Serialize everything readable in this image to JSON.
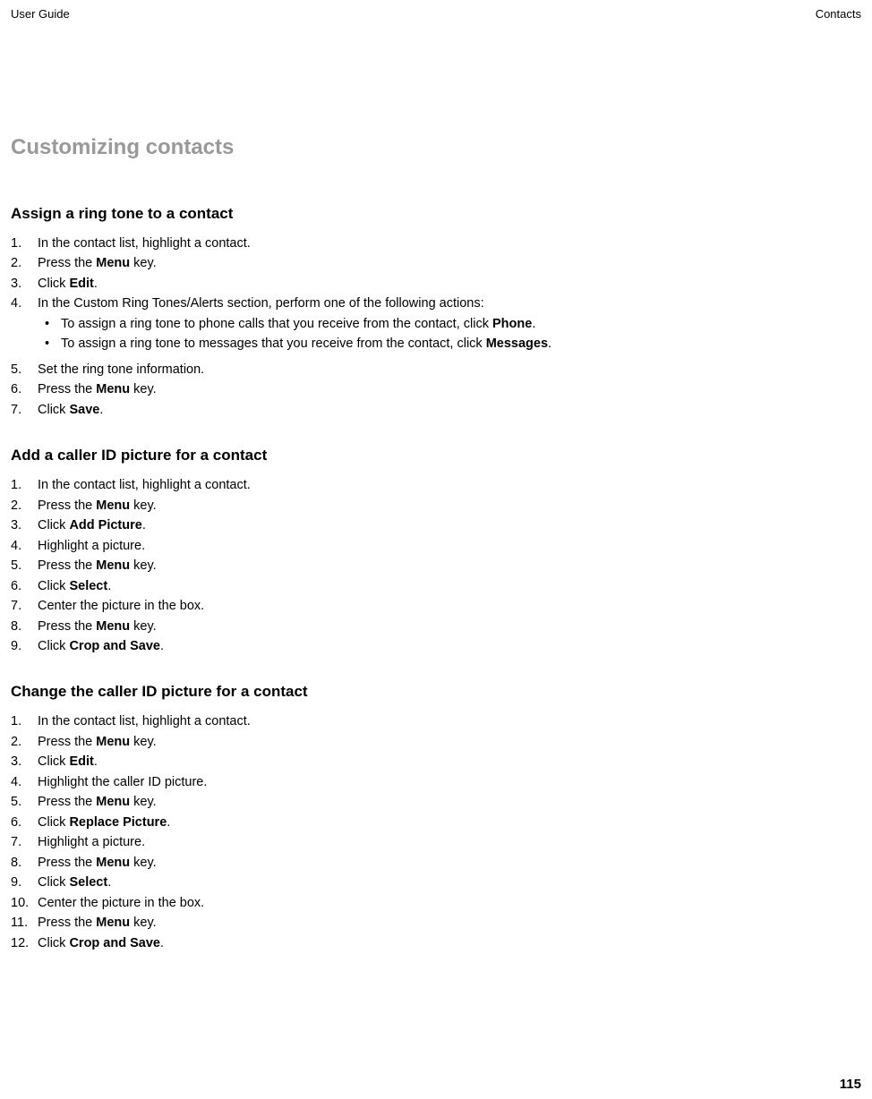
{
  "header": {
    "left": "User Guide",
    "right": "Contacts"
  },
  "main_heading": "Customizing contacts",
  "sections": [
    {
      "heading": "Assign a ring tone to a contact",
      "steps": [
        [
          {
            "t": "In the contact list, highlight a contact."
          }
        ],
        [
          {
            "t": "Press the "
          },
          {
            "t": "Menu",
            "b": true
          },
          {
            "t": " key."
          }
        ],
        [
          {
            "t": "Click "
          },
          {
            "t": "Edit",
            "b": true
          },
          {
            "t": "."
          }
        ],
        [
          {
            "t": "In the Custom Ring Tones/Alerts section, perform one of the following actions:"
          }
        ],
        [
          {
            "t": "Set the ring tone information."
          }
        ],
        [
          {
            "t": "Press the "
          },
          {
            "t": "Menu",
            "b": true
          },
          {
            "t": " key."
          }
        ],
        [
          {
            "t": "Click "
          },
          {
            "t": "Save",
            "b": true
          },
          {
            "t": "."
          }
        ]
      ],
      "sub_after_step": 4,
      "subs": [
        [
          {
            "t": "To assign a ring tone to phone calls that you receive from the contact, click "
          },
          {
            "t": "Phone",
            "b": true
          },
          {
            "t": "."
          }
        ],
        [
          {
            "t": "To assign a ring tone to messages that you receive from the contact, click "
          },
          {
            "t": "Messages",
            "b": true
          },
          {
            "t": "."
          }
        ]
      ]
    },
    {
      "heading": "Add a caller ID picture for a contact",
      "steps": [
        [
          {
            "t": "In the contact list, highlight a contact."
          }
        ],
        [
          {
            "t": "Press the "
          },
          {
            "t": "Menu",
            "b": true
          },
          {
            "t": " key."
          }
        ],
        [
          {
            "t": "Click "
          },
          {
            "t": "Add Picture",
            "b": true
          },
          {
            "t": "."
          }
        ],
        [
          {
            "t": "Highlight a picture."
          }
        ],
        [
          {
            "t": "Press the "
          },
          {
            "t": "Menu",
            "b": true
          },
          {
            "t": " key."
          }
        ],
        [
          {
            "t": "Click "
          },
          {
            "t": "Select",
            "b": true
          },
          {
            "t": "."
          }
        ],
        [
          {
            "t": "Center the picture in the box."
          }
        ],
        [
          {
            "t": "Press the "
          },
          {
            "t": "Menu",
            "b": true
          },
          {
            "t": " key."
          }
        ],
        [
          {
            "t": "Click "
          },
          {
            "t": "Crop and Save",
            "b": true
          },
          {
            "t": "."
          }
        ]
      ]
    },
    {
      "heading": "Change the caller ID picture for a contact",
      "steps": [
        [
          {
            "t": "In the contact list, highlight a contact."
          }
        ],
        [
          {
            "t": "Press the "
          },
          {
            "t": "Menu",
            "b": true
          },
          {
            "t": " key."
          }
        ],
        [
          {
            "t": "Click "
          },
          {
            "t": "Edit",
            "b": true
          },
          {
            "t": "."
          }
        ],
        [
          {
            "t": "Highlight the caller ID picture."
          }
        ],
        [
          {
            "t": "Press the "
          },
          {
            "t": "Menu",
            "b": true
          },
          {
            "t": " key."
          }
        ],
        [
          {
            "t": "Click "
          },
          {
            "t": "Replace Picture",
            "b": true
          },
          {
            "t": "."
          }
        ],
        [
          {
            "t": "Highlight a picture."
          }
        ],
        [
          {
            "t": "Press the "
          },
          {
            "t": "Menu",
            "b": true
          },
          {
            "t": " key."
          }
        ],
        [
          {
            "t": "Click "
          },
          {
            "t": "Select",
            "b": true
          },
          {
            "t": "."
          }
        ],
        [
          {
            "t": "Center the picture in the box."
          }
        ],
        [
          {
            "t": "Press the "
          },
          {
            "t": "Menu",
            "b": true
          },
          {
            "t": " key."
          }
        ],
        [
          {
            "t": "Click "
          },
          {
            "t": "Crop and Save",
            "b": true
          },
          {
            "t": "."
          }
        ]
      ]
    }
  ],
  "page_number": "115"
}
